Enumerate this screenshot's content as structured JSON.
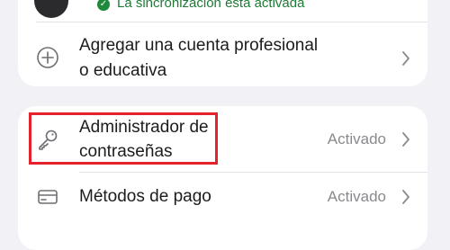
{
  "account": {
    "sync_status": "La sincronización está activada"
  },
  "menu": {
    "add_account": {
      "label_line1": "Agregar una cuenta profesional",
      "label_line2": "o educativa",
      "icon": "plus-circle-icon"
    },
    "password_manager": {
      "label_line1": "Administrador de",
      "label_line2": "contraseñas",
      "status": "Activado",
      "icon": "key-icon"
    },
    "payment_methods": {
      "label": "Métodos de pago",
      "status": "Activado",
      "icon": "card-icon"
    }
  },
  "colors": {
    "sync_green": "#1f8a3b",
    "highlight_red": "#e3222b",
    "background": "#f2f1f6"
  }
}
